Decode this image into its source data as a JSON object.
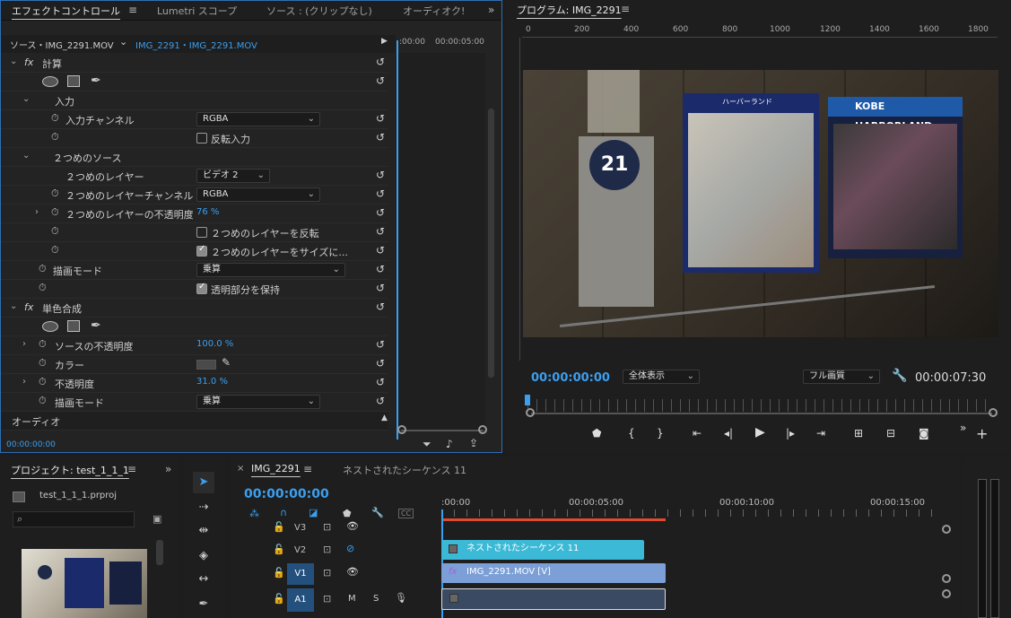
{
  "effect_panel": {
    "tabs": [
      "エフェクトコントロール",
      "Lumetri スコープ",
      "ソース : (クリップなし)",
      "オーディオク!"
    ],
    "source_label": "ソース・IMG_2291.MOV",
    "clip_label": "IMG_2291・IMG_2291.MOV",
    "ruler_start": ":00:00",
    "ruler_mid": "00:00:05:00",
    "calc_name": "計算",
    "input_section": "入力",
    "input_channel_label": "入力チャンネル",
    "input_channel_value": "RGBA",
    "invert_input": "反転入力",
    "second_source": "２つめのソース",
    "second_layer": "２つめのレイヤー",
    "second_layer_value": "ビデオ 2",
    "second_layer_channel": "２つめのレイヤーチャンネル",
    "second_layer_channel_value": "RGBA",
    "second_layer_opacity": "２つめのレイヤーの不透明度",
    "second_layer_opacity_value": "76 %",
    "invert_second": "２つめのレイヤーを反転",
    "resize_second": "２つめのレイヤーをサイズに...",
    "blend_mode": "描画モード",
    "blend_mode_value": "乗算",
    "preserve_transparency": "透明部分を保持",
    "color_composite": "単色合成",
    "source_opacity": "ソースの不透明度",
    "source_opacity_value": "100.0 %",
    "color": "カラー",
    "opacity": "不透明度",
    "opacity_value": "31.0 %",
    "blend_mode2": "描画モード",
    "blend_mode2_value": "乗算",
    "audio": "オーディオ",
    "timecode": "00:00:00:00"
  },
  "program": {
    "title": "プログラム: IMG_2291",
    "ruler": [
      "0",
      "200",
      "400",
      "600",
      "800",
      "1000",
      "1200",
      "1400",
      "1600",
      "1800"
    ],
    "timecode": "00:00:00:00",
    "zoom": "全体表示",
    "quality": "フル画質",
    "duration": "00:00:07:30",
    "sign_text": "KOBE HARBORLAND",
    "map_text": "ハーバーランド",
    "station_number": "21"
  },
  "project": {
    "title": "プロジェクト: test_1_1_1",
    "file": "test_1_1_1.prproj"
  },
  "timeline": {
    "tab1": "IMG_2291",
    "tab2": "ネストされたシーケンス 11",
    "timecode": "00:00:00:00",
    "ruler": [
      ":00:00",
      "00:00:05:00",
      "00:00:10:00",
      "00:00:15:00"
    ],
    "tracks": [
      "V3",
      "V2",
      "V1",
      "A1"
    ],
    "clip_v2": "ネストされたシーケンス 11",
    "clip_v1": "IMG_2291.MOV [V]",
    "cc": "CC",
    "mute": "M",
    "solo": "S"
  }
}
